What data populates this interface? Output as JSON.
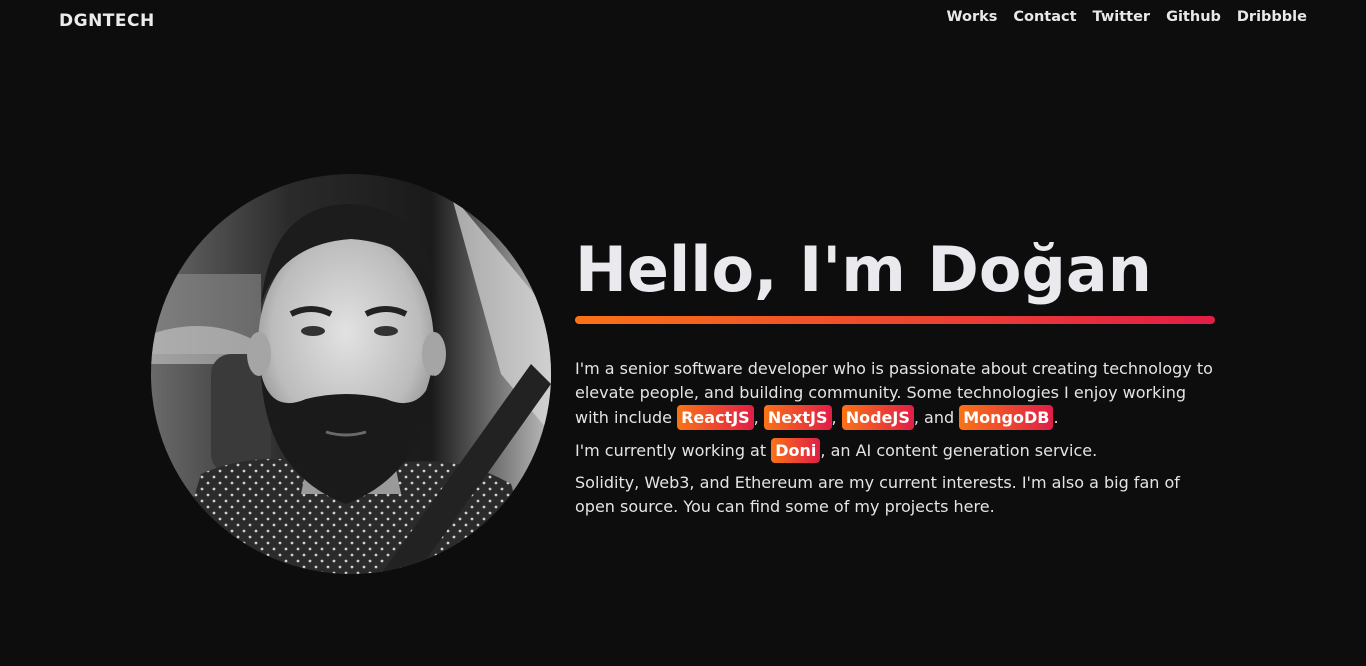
{
  "header": {
    "logo": "DGNTECH",
    "nav": [
      {
        "label": "Works"
      },
      {
        "label": "Contact"
      },
      {
        "label": "Twitter"
      },
      {
        "label": "Github"
      },
      {
        "label": "Dribbble"
      }
    ]
  },
  "hero": {
    "title": "Hello, I'm Doğan",
    "para1": {
      "text": "I'm a senior software developer who is passionate about creating technology to elevate people, and building community. Some technologies I enjoy working with include",
      "tags": [
        "ReactJS",
        "NextJS",
        "NodeJS",
        "MongoDB"
      ],
      "sep1": ", ",
      "sep2": ", ",
      "sep3": ", and ",
      "end": "."
    },
    "para2": {
      "before": "I'm currently working at",
      "tag": "Doni",
      "after": ", an AI content generation service."
    },
    "para3": "Solidity, Web3, and Ethereum are my current interests. I'm also a big fan of open source. You can find some of my projects here."
  },
  "colors": {
    "background": "#0d0d0e",
    "gradient_start": "#f97316",
    "gradient_end": "#e11d48"
  }
}
